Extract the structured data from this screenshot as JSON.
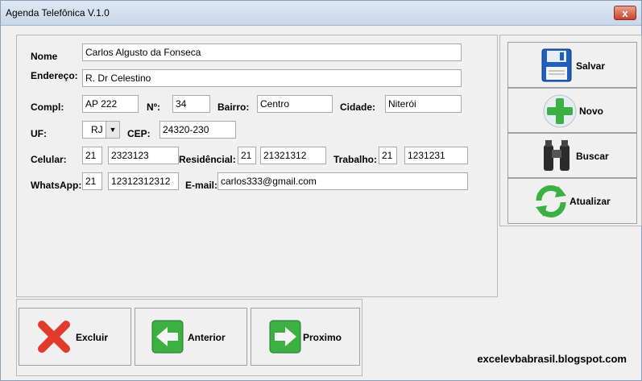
{
  "window": {
    "title": "Agenda Telefônica V.1.0",
    "close_symbol": "x"
  },
  "form": {
    "nome": {
      "label": "Nome",
      "value": "Carlos Algusto da Fonseca"
    },
    "endereco": {
      "label": "Endereço:",
      "value": "R. Dr Celestino"
    },
    "compl": {
      "label": "Compl:",
      "value": "AP 222"
    },
    "numero": {
      "label": "Nº:",
      "value": "34"
    },
    "bairro": {
      "label": "Bairro:",
      "value": "Centro"
    },
    "cidade": {
      "label": "Cidade:",
      "value": "Niterói"
    },
    "uf": {
      "label": "UF:",
      "value": "RJ"
    },
    "cep": {
      "label": "CEP:",
      "value": "24320-230"
    },
    "celular": {
      "label": "Celular:",
      "ddd": "21",
      "value": "2323123"
    },
    "residencial": {
      "label": "Residêncial:",
      "ddd": "21",
      "value": "21321312"
    },
    "trabalho": {
      "label": "Trabalho:",
      "ddd": "21",
      "value": "1231231"
    },
    "whatsapp": {
      "label": "WhatsApp:",
      "ddd": "21",
      "value": "12312312312"
    },
    "email": {
      "label": "E-mail:",
      "value": "carlos333@gmail.com"
    }
  },
  "actions": {
    "salvar": "Salvar",
    "novo": "Novo",
    "buscar": "Buscar",
    "atualizar": "Atualizar",
    "excluir": "Excluir",
    "anterior": "Anterior",
    "proximo": "Proximo"
  },
  "footer": {
    "text": "excelevbabrasil.blogspot.com"
  },
  "colors": {
    "titlebar": "#c7d7ea",
    "close": "#c7432b",
    "green": "#3cb043",
    "red": "#e23b2e",
    "blue": "#2a64b4"
  }
}
